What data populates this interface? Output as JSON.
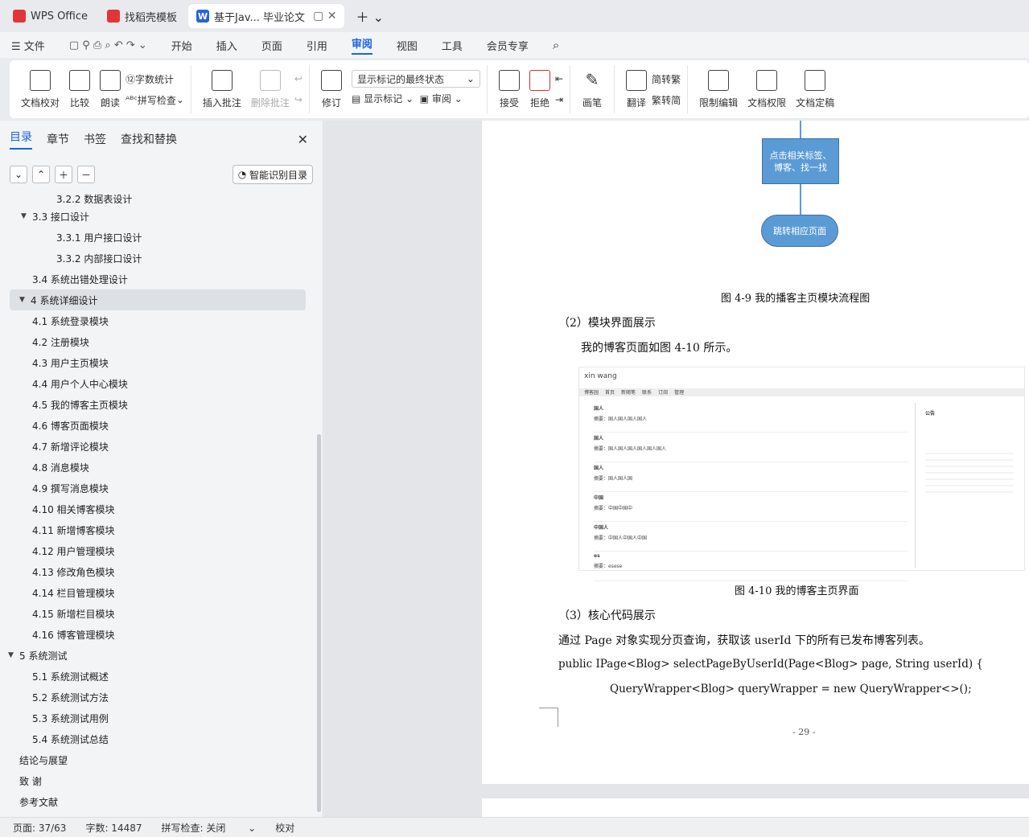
{
  "tabs": [
    {
      "label": "WPS Office",
      "icon": "wps-logo-icon",
      "color": "#e3343a"
    },
    {
      "label": "找稻壳模板",
      "icon": "docer-icon",
      "color": "#e3343a"
    },
    {
      "label": "基于Jav... 毕业论文",
      "icon": "word-doc-icon",
      "color": "#2b63d9",
      "active": true
    }
  ],
  "menu": [
    "文件",
    "开始",
    "插入",
    "页面",
    "引用",
    "审阅",
    "视图",
    "工具",
    "会员专享"
  ],
  "menu_active": "审阅",
  "ribbon": {
    "proof": "文档校对",
    "compare": "比较",
    "read": "朗读",
    "wordcount": "字数统计",
    "spell": "拼写检查",
    "insert_comment": "插入批注",
    "delete_comment": "删除批注",
    "revise": "修订",
    "markup_state": "显示标记的最终状态",
    "show_markup": "显示标记",
    "review": "审阅",
    "accept": "接受",
    "reject": "拒绝",
    "pen": "画笔",
    "translate": "翻译",
    "to_trad": "转繁",
    "to_simp": "转简",
    "restrict": "限制编辑",
    "permission": "文档权限",
    "finalize": "文档定稿"
  },
  "sidebar": {
    "tabs": [
      "目录",
      "章节",
      "书签",
      "查找和替换"
    ],
    "active": "目录",
    "smart": "智能识别目录",
    "toc": [
      {
        "t": "3.2.2  数据表设计",
        "l": 3
      },
      {
        "t": "3.3  接口设计",
        "l": 2,
        "c": true
      },
      {
        "t": "3.3.1  用户接口设计",
        "l": 3
      },
      {
        "t": "3.3.2  内部接口设计",
        "l": 3
      },
      {
        "t": "3.4  系统出错处理设计",
        "l": 2
      },
      {
        "t": "4  系统详细设计",
        "l": 1,
        "c": true,
        "sel": true
      },
      {
        "t": "4.1  系统登录模块",
        "l": 2
      },
      {
        "t": "4.2  注册模块",
        "l": 2
      },
      {
        "t": "4.3  用户主页模块",
        "l": 2
      },
      {
        "t": "4.4  用户个人中心模块",
        "l": 2
      },
      {
        "t": "4.5  我的博客主页模块",
        "l": 2
      },
      {
        "t": "4.6  博客页面模块",
        "l": 2
      },
      {
        "t": "4.7  新增评论模块",
        "l": 2
      },
      {
        "t": "4.8  消息模块",
        "l": 2
      },
      {
        "t": "4.9  撰写消息模块",
        "l": 2
      },
      {
        "t": "4.10  相关博客模块",
        "l": 2
      },
      {
        "t": "4.11  新增博客模块",
        "l": 2
      },
      {
        "t": "4.12  用户管理模块",
        "l": 2
      },
      {
        "t": "4.13  修改角色模块",
        "l": 2
      },
      {
        "t": "4.14  栏目管理模块",
        "l": 2
      },
      {
        "t": "4.15  新增栏目模块",
        "l": 2
      },
      {
        "t": "4.16  博客管理模块",
        "l": 2
      },
      {
        "t": "5  系统测试",
        "l": 1,
        "c": true
      },
      {
        "t": "5.1  系统测试概述",
        "l": 2
      },
      {
        "t": "5.2  系统测试方法",
        "l": 2
      },
      {
        "t": "5.3  系统测试用例",
        "l": 2
      },
      {
        "t": "5.4  系统测试总结",
        "l": 2
      },
      {
        "t": "结论与展望",
        "l": 1
      },
      {
        "t": "致    谢",
        "l": 1
      },
      {
        "t": "参考文献",
        "l": 1
      }
    ]
  },
  "doc": {
    "box1": "点击相关标签、博客、找一找",
    "term": "跳转相应页面",
    "fig49": "图 4-9  我的播客主页模块流程图",
    "h2": "（2）模块界面展示",
    "p1": "我的博客页面如图 4-10 所示。",
    "fig410": "图 4-10  我的博客主页界面",
    "h3": "（3）核心代码展示",
    "p2": "通过 Page 对象实现分页查询，获取该 userId 下的所有已发布博客列表。",
    "code1": "public IPage<Blog> selectPageByUserId(Page<Blog> page, String userId) {",
    "code2": "QueryWrapper<Blog> queryWrapper = new QueryWrapper<>();",
    "pageno": "- 29 -",
    "shot": {
      "user": "xin wang",
      "nav": [
        "博客园",
        "首页",
        "新随笔",
        "联系",
        "订阅",
        "管理"
      ],
      "posts": [
        {
          "title": "国人",
          "summary": "摘要：国人国人国人国人"
        },
        {
          "title": "国人",
          "summary": "摘要：国人国人国人国人国人国人"
        },
        {
          "title": "国人",
          "summary": "摘要：国人国人国"
        },
        {
          "title": "中国",
          "summary": "摘要：中国中国中"
        },
        {
          "title": "中国人",
          "summary": "摘要：中国人中国人中国"
        },
        {
          "title": "es",
          "summary": "摘要：esese"
        }
      ],
      "notice": "公告"
    }
  },
  "status": {
    "page": "页面: 37/63",
    "words": "字数: 14487",
    "spell": "拼写检查: 关闭",
    "proof": "校对"
  }
}
